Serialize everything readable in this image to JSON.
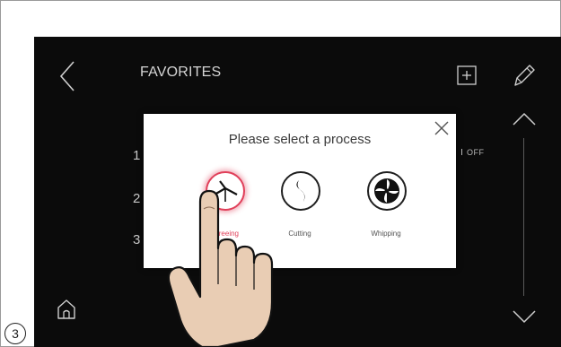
{
  "header": {
    "title": "FAVORITES"
  },
  "list": {
    "rows": [
      "1",
      "2",
      "3"
    ],
    "status": "OFF"
  },
  "modal": {
    "title": "Please select a process",
    "processes": [
      {
        "label": "Pureeing",
        "icon": "pureeing-blade-icon",
        "selected": true
      },
      {
        "label": "Cutting",
        "icon": "cutting-blade-icon",
        "selected": false
      },
      {
        "label": "Whipping",
        "icon": "whipping-disc-icon",
        "selected": false
      }
    ]
  },
  "step_badge": "3",
  "colors": {
    "screen_bg": "#0b0b0b",
    "accent_selected": "#e0405a",
    "modal_bg": "#ffffff"
  }
}
